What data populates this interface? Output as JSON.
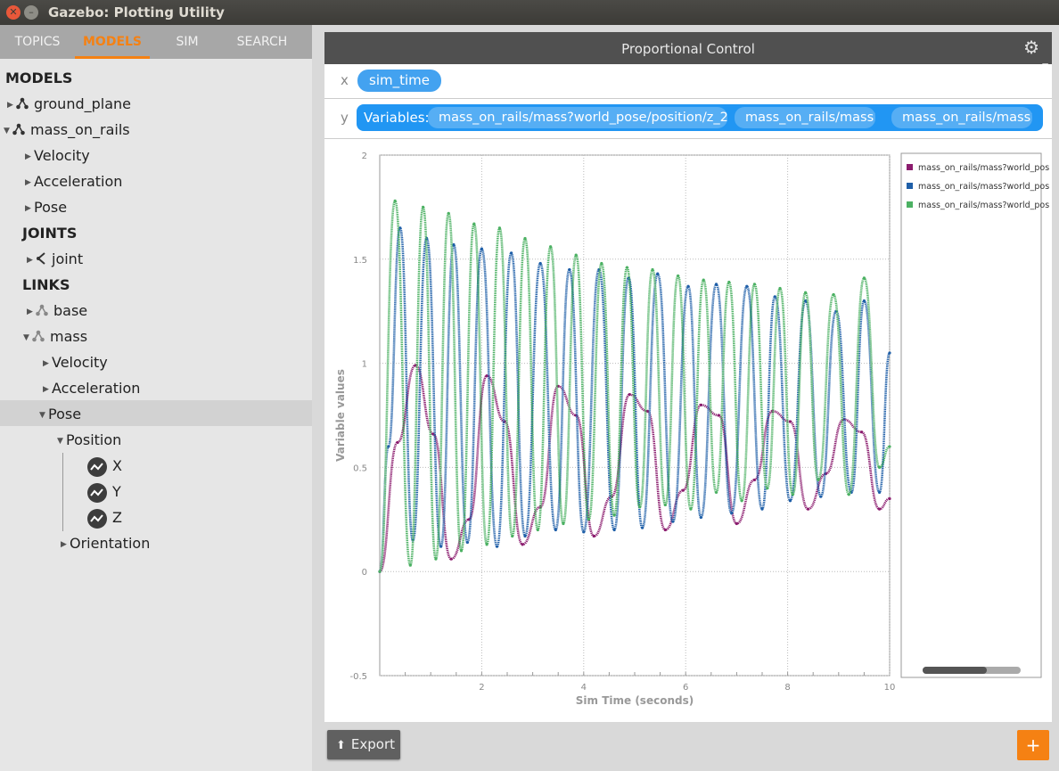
{
  "window": {
    "title": "Gazebo: Plotting Utility"
  },
  "tabs": [
    {
      "label": "TOPICS",
      "active": false
    },
    {
      "label": "MODELS",
      "active": true
    },
    {
      "label": "SIM",
      "active": false
    },
    {
      "label": "SEARCH",
      "active": false
    }
  ],
  "tree": {
    "models_header": "MODELS",
    "ground_plane": "ground_plane",
    "mass_on_rails": "mass_on_rails",
    "velocity": "Velocity",
    "acceleration": "Acceleration",
    "pose": "Pose",
    "joints_header": "JOINTS",
    "joint": "joint",
    "links_header": "LINKS",
    "base": "base",
    "mass": "mass",
    "mass_velocity": "Velocity",
    "mass_acceleration": "Acceleration",
    "mass_pose": "Pose",
    "position": "Position",
    "x": "X",
    "y": "Y",
    "z": "Z",
    "orientation": "Orientation"
  },
  "plot": {
    "title": "Proportional Control",
    "x_label": "x",
    "x_variable": "sim_time",
    "y_label": "y",
    "variables_label": "Variables:",
    "variables": [
      "mass_on_rails/mass?world_pose/position/z_2",
      "mass_on_rails/mass?world_pose/position/x",
      "mass_on_rails/mass?world_pose/position/y"
    ],
    "export_label": "Export",
    "add_label": "+"
  },
  "colors": {
    "accent": "#f58113",
    "pill": "#2196f3",
    "series": [
      "#8b1c6e",
      "#1f5fa8",
      "#4cb163"
    ]
  },
  "chart_data": {
    "type": "scatter",
    "title": "",
    "xlabel": "Sim Time (seconds)",
    "ylabel": "Variable values",
    "xlim": [
      0,
      10
    ],
    "ylim": [
      -0.5,
      2
    ],
    "xticks": [
      2,
      4,
      6,
      8,
      10
    ],
    "yticks": [
      -0.5,
      0,
      0.5,
      1,
      1.5,
      2
    ],
    "grid": true,
    "legend": "right",
    "series": [
      {
        "name": "mass_on_rails/mass?world_pos",
        "color": "#8b1c6e",
        "x": [
          0,
          0.35,
          0.7,
          1.05,
          1.4,
          1.75,
          2.1,
          2.45,
          2.8,
          3.15,
          3.5,
          3.85,
          4.2,
          4.55,
          4.9,
          5.25,
          5.6,
          5.95,
          6.3,
          6.65,
          7.0,
          7.35,
          7.7,
          8.05,
          8.4,
          8.75,
          9.1,
          9.45,
          9.8,
          10
        ],
        "y": [
          0,
          0.62,
          0.99,
          0.66,
          0.06,
          0.25,
          0.94,
          0.72,
          0.13,
          0.31,
          0.89,
          0.75,
          0.17,
          0.36,
          0.85,
          0.77,
          0.2,
          0.39,
          0.8,
          0.75,
          0.23,
          0.44,
          0.77,
          0.72,
          0.3,
          0.47,
          0.73,
          0.67,
          0.3,
          0.35
        ]
      },
      {
        "name": "mass_on_rails/mass?world_pos",
        "color": "#1f5fa8",
        "x": [
          0,
          0.17,
          0.4,
          0.65,
          0.92,
          1.2,
          1.45,
          1.72,
          2.0,
          2.3,
          2.58,
          2.85,
          3.15,
          3.45,
          3.72,
          4.0,
          4.3,
          4.6,
          4.88,
          5.15,
          5.45,
          5.75,
          6.05,
          6.3,
          6.6,
          6.9,
          7.2,
          7.5,
          7.75,
          8.05,
          8.35,
          8.65,
          8.95,
          9.25,
          9.5,
          9.8,
          10
        ],
        "y": [
          0,
          0.6,
          1.65,
          0.15,
          1.6,
          0.12,
          1.57,
          0.14,
          1.55,
          0.12,
          1.53,
          0.17,
          1.48,
          0.2,
          1.45,
          0.19,
          1.45,
          0.2,
          1.41,
          0.21,
          1.43,
          0.24,
          1.37,
          0.26,
          1.38,
          0.28,
          1.37,
          0.3,
          1.32,
          0.34,
          1.3,
          0.36,
          1.25,
          0.38,
          1.3,
          0.38,
          1.05
        ]
      },
      {
        "name": "mass_on_rails/mass?world_pos",
        "color": "#4cb163",
        "x": [
          0,
          0.3,
          0.6,
          0.85,
          1.1,
          1.35,
          1.6,
          1.85,
          2.1,
          2.35,
          2.6,
          2.85,
          3.1,
          3.35,
          3.6,
          3.85,
          4.1,
          4.35,
          4.6,
          4.85,
          5.1,
          5.35,
          5.6,
          5.85,
          6.1,
          6.35,
          6.6,
          6.85,
          7.1,
          7.35,
          7.6,
          7.85,
          8.1,
          8.35,
          8.6,
          8.9,
          9.2,
          9.5,
          9.8,
          10
        ],
        "y": [
          0,
          1.78,
          0.03,
          1.75,
          0.06,
          1.72,
          0.1,
          1.67,
          0.13,
          1.65,
          0.17,
          1.6,
          0.2,
          1.56,
          0.23,
          1.52,
          0.25,
          1.48,
          0.27,
          1.46,
          0.31,
          1.45,
          0.32,
          1.42,
          0.3,
          1.4,
          0.38,
          1.39,
          0.34,
          1.38,
          0.4,
          1.36,
          0.37,
          1.34,
          0.44,
          1.33,
          0.37,
          1.41,
          0.5,
          0.6
        ]
      }
    ]
  }
}
